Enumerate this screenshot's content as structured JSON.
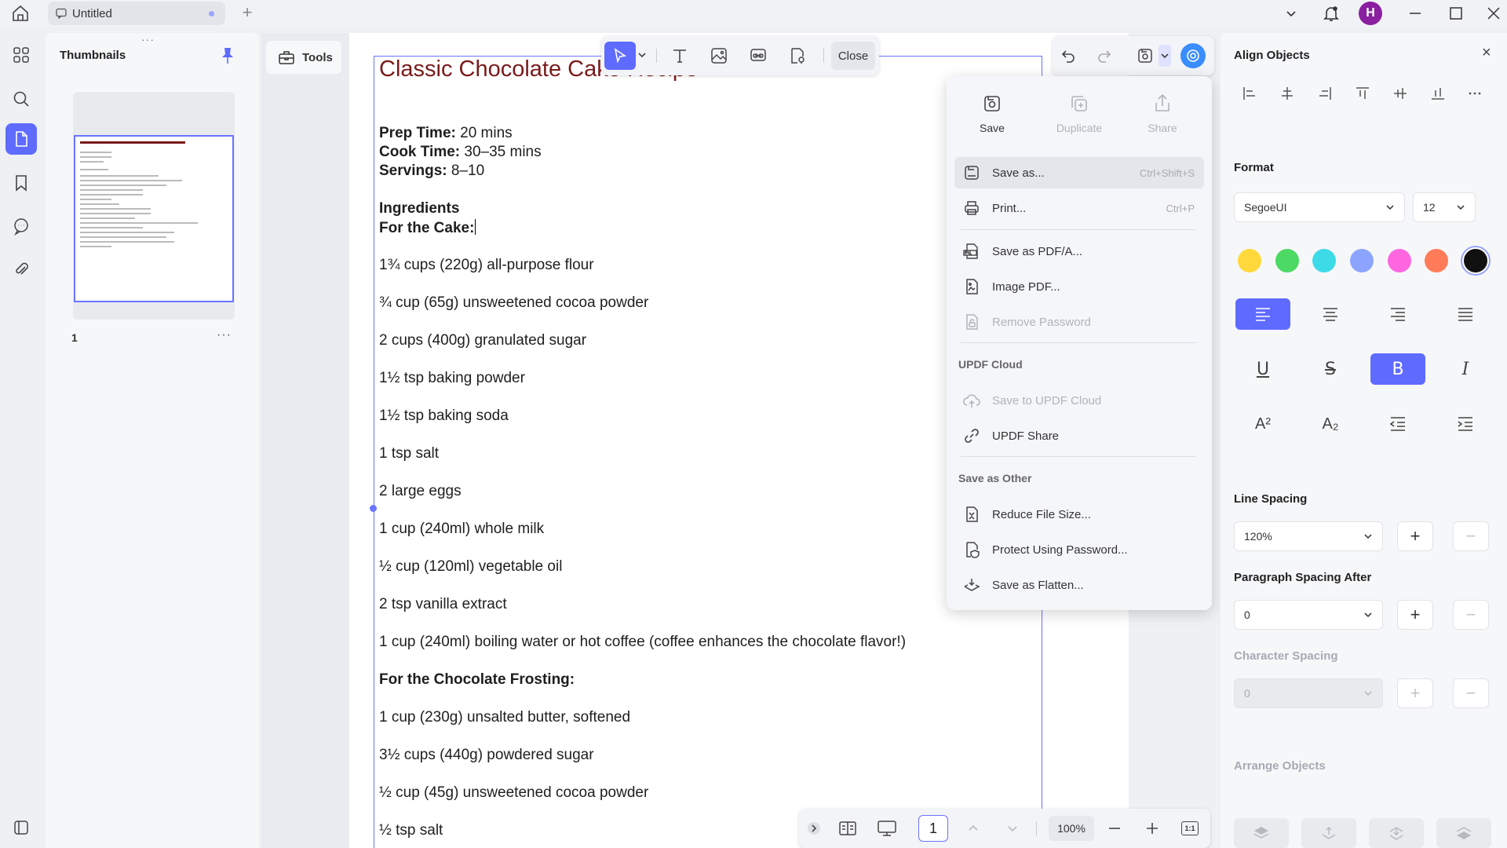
{
  "app": {
    "tab_title": "Untitled",
    "avatar_letter": "H"
  },
  "thumbnails": {
    "title": "Thumbnails",
    "page_number": "1",
    "more": "···"
  },
  "tools": {
    "label": "Tools"
  },
  "edit_toolbar": {
    "close_label": "Close"
  },
  "document": {
    "title": "Classic Chocolate Cake Recipe",
    "prep_label": "Prep Time:",
    "prep_value": " 20 mins",
    "cook_label": "Cook Time:",
    "cook_value": " 30–35 mins",
    "servings_label": "Servings:",
    "servings_value": " 8–10",
    "ingredients_heading": "Ingredients",
    "cake_heading": "For the Cake:",
    "cake_items": [
      "1¾ cups (220g) all-purpose flour",
      "¾ cup (65g) unsweetened cocoa powder",
      "2 cups (400g) granulated sugar",
      "1½ tsp baking powder",
      "1½ tsp baking soda",
      "1 tsp salt",
      "2 large eggs",
      "1 cup (240ml) whole milk",
      "½ cup (120ml) vegetable oil",
      "2 tsp vanilla extract",
      "1 cup (240ml) boiling water or hot coffee (coffee enhances the chocolate flavor!)"
    ],
    "frosting_heading": "For the Chocolate Frosting:",
    "frosting_items": [
      "1 cup (230g) unsalted butter, softened",
      "3½ cups (440g) powdered sugar",
      "½ cup (45g) unsweetened cocoa powder",
      "½ tsp salt"
    ]
  },
  "save_menu": {
    "top": [
      {
        "label": "Save",
        "enabled": true
      },
      {
        "label": "Duplicate",
        "enabled": false
      },
      {
        "label": "Share",
        "enabled": false
      }
    ],
    "save_as": {
      "label": "Save as...",
      "shortcut": "Ctrl+Shift+S"
    },
    "print": {
      "label": "Print...",
      "shortcut": "Ctrl+P"
    },
    "save_pdfa": "Save as PDF/A...",
    "image_pdf": "Image PDF...",
    "remove_password": "Remove Password",
    "section_cloud": "UPDF Cloud",
    "save_cloud": "Save to UPDF Cloud",
    "updf_share": "UPDF Share",
    "section_other": "Save as Other",
    "reduce_size": "Reduce File Size...",
    "protect_password": "Protect Using Password...",
    "save_flatten": "Save as Flatten..."
  },
  "properties": {
    "align_title": "Align Objects",
    "format_title": "Format",
    "font_family": "SegoeUI",
    "font_size": "12",
    "swatches": [
      "#ffd93b",
      "#4cd964",
      "#3ddbe8",
      "#8da4ff",
      "#ff66e0",
      "#ff7b5a",
      "#111111"
    ],
    "line_spacing_title": "Line Spacing",
    "line_spacing_value": "120%",
    "para_spacing_title": "Paragraph Spacing After",
    "para_spacing_value": "0",
    "char_spacing_title": "Character Spacing",
    "char_spacing_value": "0",
    "arrange_title": "Arrange Objects",
    "superscript": "A²",
    "subscript": "A₂",
    "bold": "B",
    "italic": "I",
    "underline": "U",
    "strike": "S"
  },
  "bottom_bar": {
    "page": "1",
    "zoom": "100%",
    "fit_label": "1:1"
  },
  "colors": {
    "accent": "#5f6bff",
    "title_red": "#7a1a1a"
  }
}
